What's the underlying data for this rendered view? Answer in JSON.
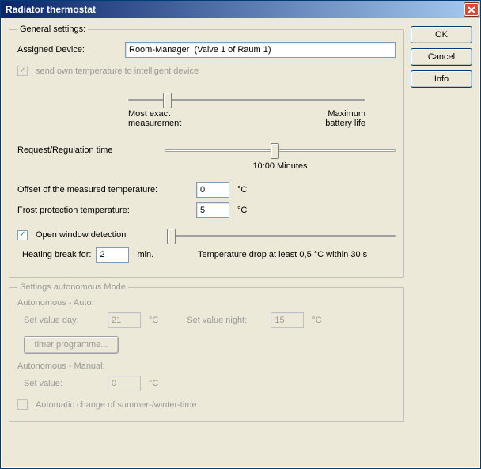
{
  "window": {
    "title": "Radiator thermostat"
  },
  "buttons": {
    "ok": "OK",
    "cancel": "Cancel",
    "info": "Info"
  },
  "general": {
    "legend": "General settings:",
    "assigned_label": "Assigned Device:",
    "assigned_value": "Room-Manager  (Valve 1 of Raum 1)",
    "send_temp_checked": true,
    "send_temp_label": "send own temperature to intelligent device",
    "slider1_left": "Most exact\nmeasurement",
    "slider1_right": "Maximum\nbattery life",
    "req_label": "Request/Regulation time",
    "req_value_text": "10:00 Minutes",
    "offset_label": "Offset of the measured temperature:",
    "offset_value": "0",
    "frost_label": "Frost protection temperature:",
    "frost_value": "5",
    "celsius": "°C",
    "open_window_checked": true,
    "open_window_label": "Open window detection",
    "heating_break_label": "Heating break for:",
    "heating_break_value": "2",
    "heating_break_unit": "min.",
    "temp_drop_text": "Temperature drop at least 0,5 °C within 30 s"
  },
  "auto": {
    "legend": "Settings autonomous Mode",
    "auto_heading": "Autonomous - Auto:",
    "day_label": "Set value day:",
    "day_value": "21",
    "night_label": "Set value night:",
    "night_value": "15",
    "timer_btn": "timer programme...",
    "manual_heading": "Autonomous - Manual:",
    "manual_label": "Set value:",
    "manual_value": "0",
    "celsius": "°C",
    "dst_checked": false,
    "dst_label": "Automatic change of summer-/winter-time"
  }
}
